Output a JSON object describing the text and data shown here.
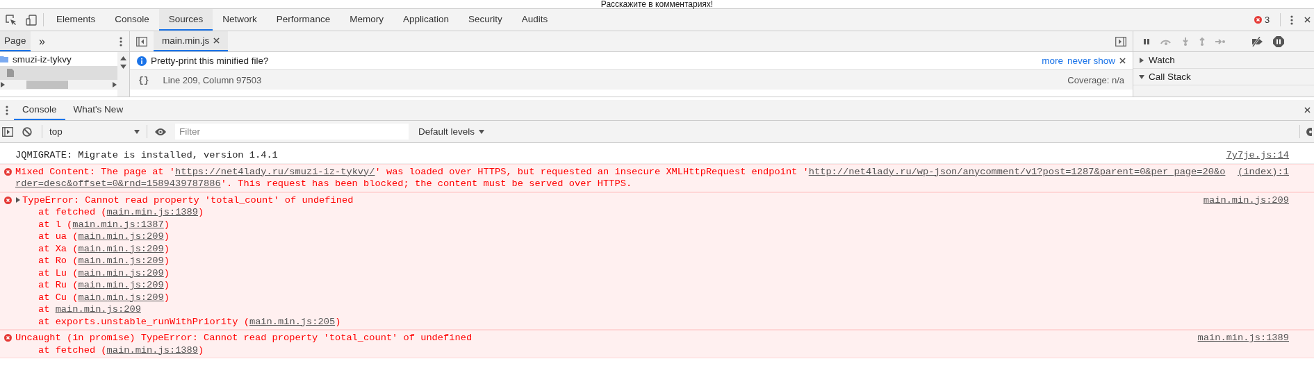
{
  "page_strip": {
    "text": "Расскажите в комментариях!"
  },
  "main_tabs": [
    {
      "label": "Elements",
      "selected": false
    },
    {
      "label": "Console",
      "selected": false
    },
    {
      "label": "Sources",
      "selected": true
    },
    {
      "label": "Network",
      "selected": false
    },
    {
      "label": "Performance",
      "selected": false
    },
    {
      "label": "Memory",
      "selected": false
    },
    {
      "label": "Application",
      "selected": false
    },
    {
      "label": "Security",
      "selected": false
    },
    {
      "label": "Audits",
      "selected": false
    }
  ],
  "error_count": "3",
  "navigator": {
    "tabs": [
      {
        "label": "Page",
        "selected": true
      }
    ],
    "more": "»",
    "tree": [
      {
        "kind": "folder",
        "name": "smuzi-iz-tykvy"
      },
      {
        "kind": "file"
      }
    ]
  },
  "editor_tabs": [
    {
      "label": "main.min.js",
      "selected": true
    }
  ],
  "infobar": {
    "message": "Pretty-print this minified file?",
    "links": [
      "more",
      "never show"
    ]
  },
  "status": {
    "pretty_print": "{}",
    "position": "Line 209, Column 97503",
    "coverage": "Coverage: n/a"
  },
  "debugger": {
    "sections": [
      {
        "label": "Watch",
        "expanded": false
      },
      {
        "label": "Call Stack",
        "expanded": true
      }
    ]
  },
  "drawer_tabs": [
    {
      "label": "Console",
      "selected": true
    },
    {
      "label": "What's New",
      "selected": false
    }
  ],
  "console_toolbar": {
    "context": "top",
    "filter_placeholder": "Filter",
    "levels": "Default levels"
  },
  "messages": [
    {
      "kind": "info",
      "lines": [
        [
          {
            "text": "JQMIGRATE: Migrate is installed, version 1.4.1"
          }
        ]
      ],
      "source": "7y7je.js:14"
    },
    {
      "kind": "error",
      "lines": [
        [
          {
            "text": "Mixed Content: The page at '"
          },
          {
            "text": "https://net4lady.ru/smuzi-iz-tykvy/",
            "link": true
          },
          {
            "text": "' was loaded over HTTPS, but requested an insecure XMLHttpRequest endpoint '"
          },
          {
            "text": "http://net4lady.ru/wp-json/anycomment/v1?post=1287&parent=0&per_page=20&o",
            "link": true
          }
        ],
        [
          {
            "text": "rder=desc&offset=0&rnd=1589439787886",
            "link": true
          },
          {
            "text": "'. This request has been blocked; the content must be served over HTTPS."
          }
        ]
      ],
      "source": "(index):1"
    },
    {
      "kind": "error",
      "expandable": true,
      "lines": [
        [
          {
            "text": "TypeError: Cannot read property 'total_count' of undefined"
          }
        ]
      ],
      "source": "main.min.js:209",
      "frames": [
        [
          {
            "text": "at fetched ("
          },
          {
            "text": "main.min.js:1389",
            "link": true
          },
          {
            "text": ")"
          }
        ],
        [
          {
            "text": "at l ("
          },
          {
            "text": "main.min.js:1387",
            "link": true
          },
          {
            "text": ")"
          }
        ],
        [
          {
            "text": "at ua ("
          },
          {
            "text": "main.min.js:209",
            "link": true
          },
          {
            "text": ")"
          }
        ],
        [
          {
            "text": "at Xa ("
          },
          {
            "text": "main.min.js:209",
            "link": true
          },
          {
            "text": ")"
          }
        ],
        [
          {
            "text": "at Ro ("
          },
          {
            "text": "main.min.js:209",
            "link": true
          },
          {
            "text": ")"
          }
        ],
        [
          {
            "text": "at Lu ("
          },
          {
            "text": "main.min.js:209",
            "link": true
          },
          {
            "text": ")"
          }
        ],
        [
          {
            "text": "at Ru ("
          },
          {
            "text": "main.min.js:209",
            "link": true
          },
          {
            "text": ")"
          }
        ],
        [
          {
            "text": "at Cu ("
          },
          {
            "text": "main.min.js:209",
            "link": true
          },
          {
            "text": ")"
          }
        ],
        [
          {
            "text": "at "
          },
          {
            "text": "main.min.js:209",
            "link": true
          }
        ],
        [
          {
            "text": "at exports.unstable_runWithPriority ("
          },
          {
            "text": "main.min.js:205",
            "link": true
          },
          {
            "text": ")"
          }
        ]
      ]
    },
    {
      "kind": "error",
      "lines": [
        [
          {
            "text": "Uncaught (in promise) TypeError: Cannot read property 'total_count' of undefined"
          }
        ]
      ],
      "source": "main.min.js:1389",
      "frames": [
        [
          {
            "text": "at fetched ("
          },
          {
            "text": "main.min.js:1389",
            "link": true
          },
          {
            "text": ")"
          }
        ]
      ]
    }
  ]
}
